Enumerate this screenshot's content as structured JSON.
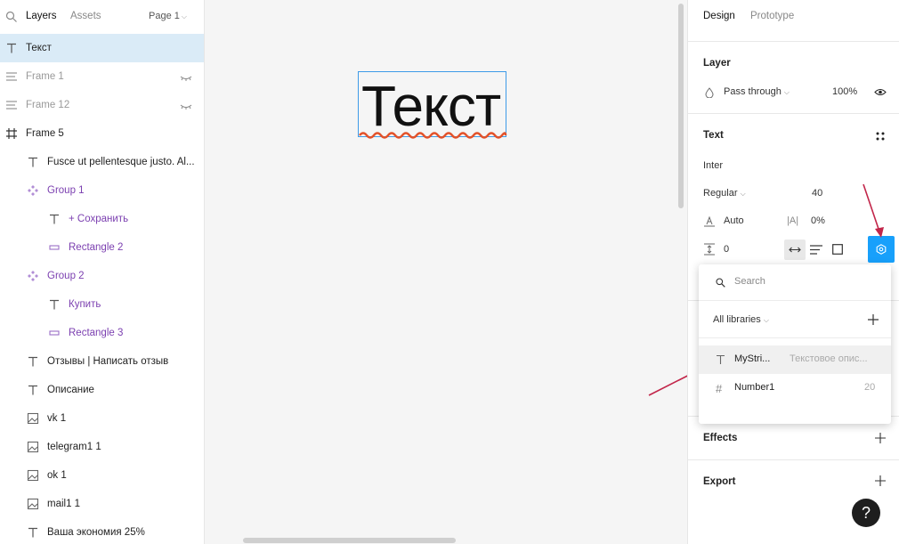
{
  "header": {
    "tab_layers": "Layers",
    "tab_assets": "Assets",
    "page_selector": "Page 1"
  },
  "layers": [
    {
      "label": "Текст",
      "icon": "text-icon",
      "indent": 0,
      "state": "selected",
      "hidden": false
    },
    {
      "label": "Frame 1",
      "icon": "autolayout-icon",
      "indent": 0,
      "state": "dim",
      "hidden": true
    },
    {
      "label": "Frame 12",
      "icon": "autolayout-icon",
      "indent": 0,
      "state": "dim",
      "hidden": true
    },
    {
      "label": "Frame 5",
      "icon": "frame-icon",
      "indent": 0,
      "state": "normal",
      "hidden": false
    },
    {
      "label": "Fusce ut pellentesque justo. Al...",
      "icon": "text-icon",
      "indent": 1,
      "state": "normal",
      "hidden": false
    },
    {
      "label": "Group 1",
      "icon": "component-icon",
      "indent": 1,
      "state": "purple",
      "hidden": false
    },
    {
      "label": "+ Сохранить",
      "icon": "text-icon",
      "indent": 2,
      "state": "purple",
      "hidden": false
    },
    {
      "label": "Rectangle 2",
      "icon": "rectangle-icon",
      "indent": 2,
      "state": "purple",
      "hidden": false
    },
    {
      "label": "Group 2",
      "icon": "component-icon",
      "indent": 1,
      "state": "purple",
      "hidden": false
    },
    {
      "label": "Купить",
      "icon": "text-icon",
      "indent": 2,
      "state": "purple",
      "hidden": false
    },
    {
      "label": "Rectangle 3",
      "icon": "rectangle-icon",
      "indent": 2,
      "state": "purple",
      "hidden": false
    },
    {
      "label": "Отзывы | Написать отзыв",
      "icon": "text-icon",
      "indent": 1,
      "state": "normal",
      "hidden": false
    },
    {
      "label": "Описание",
      "icon": "text-icon",
      "indent": 1,
      "state": "normal",
      "hidden": false
    },
    {
      "label": "vk 1",
      "icon": "image-icon",
      "indent": 1,
      "state": "normal",
      "hidden": false
    },
    {
      "label": "telegram1 1",
      "icon": "image-icon",
      "indent": 1,
      "state": "normal",
      "hidden": false
    },
    {
      "label": "ok 1",
      "icon": "image-icon",
      "indent": 1,
      "state": "normal",
      "hidden": false
    },
    {
      "label": "mail1 1",
      "icon": "image-icon",
      "indent": 1,
      "state": "normal",
      "hidden": false
    },
    {
      "label": "Ваша экономия 25%",
      "icon": "text-icon",
      "indent": 1,
      "state": "normal",
      "hidden": false
    }
  ],
  "canvas": {
    "text_content": "Текст"
  },
  "design": {
    "tab_design": "Design",
    "tab_prototype": "Prototype",
    "layer_section_title": "Layer",
    "blend_mode": "Pass through",
    "opacity": "100%",
    "text_section_title": "Text",
    "font_family": "Inter",
    "font_weight": "Regular",
    "font_size": "40",
    "line_height": "Auto",
    "letter_spacing": "0%",
    "paragraph_spacing": "0",
    "effects_title": "Effects",
    "export_title": "Export"
  },
  "popup": {
    "search_placeholder": "Search",
    "library_filter": "All libraries",
    "rows": [
      {
        "name": "MyStri...",
        "value": "Текстовое опис...",
        "icon": "text-icon"
      },
      {
        "name": "Number1",
        "value": "20",
        "icon": "hash-icon"
      }
    ]
  },
  "help": {
    "label": "?"
  },
  "colors": {
    "selection": "#daebf7",
    "accent": "#18a0fb",
    "frame_border": "#3e9be8",
    "component_purple": "#7b3fb0",
    "squiggle": "#e2522a",
    "arrow": "#c2264a"
  }
}
